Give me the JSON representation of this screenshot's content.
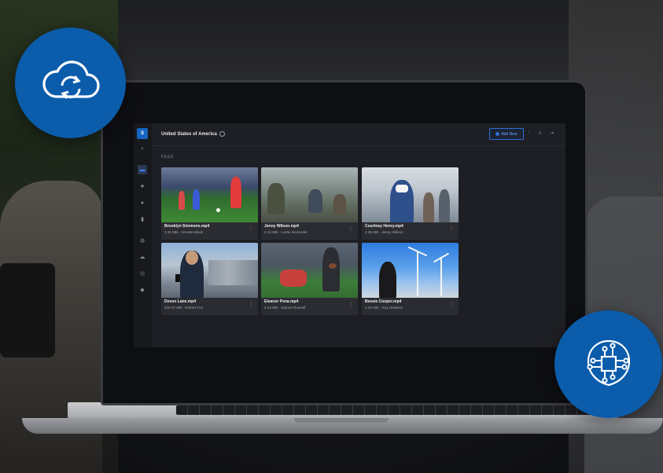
{
  "app": {
    "logo_letter": "S",
    "breadcrumb": "United States of America",
    "add_button": "Add New",
    "section_label": "FILES",
    "accent": "#1565c0"
  },
  "sidebar": {
    "items": [
      {
        "icon": "search-icon",
        "glyph": "⌕"
      },
      {
        "icon": "folder-icon",
        "glyph": "▬",
        "active": true
      },
      {
        "icon": "star-icon",
        "glyph": "★"
      },
      {
        "icon": "clock-icon",
        "glyph": "●"
      },
      {
        "icon": "trash-icon",
        "glyph": "▮"
      },
      {
        "icon": "globe-icon",
        "glyph": "◍"
      },
      {
        "icon": "cloud-icon",
        "glyph": "☁"
      },
      {
        "icon": "settings-icon",
        "glyph": "◎"
      },
      {
        "icon": "location-icon",
        "glyph": "◆"
      }
    ]
  },
  "toolbar": {
    "icons": [
      "filter-icon",
      "list-view-icon",
      "collapse-icon"
    ]
  },
  "files": [
    {
      "name": "Brooklyn Simmons.mp4",
      "meta": "2.31 MB - Annette Black"
    },
    {
      "name": "Jenny Wilson.mp4",
      "meta": "2.34 MB - Leslie Alexander"
    },
    {
      "name": "Courtney Henry.mp4",
      "meta": "2.36 MB - Jenny Wilson"
    },
    {
      "name": "Devon Lane.mp4",
      "meta": "240.37 MB - Robert Fox"
    },
    {
      "name": "Eleanor Pena.mp4",
      "meta": "2.24 MB - Dianne Russell"
    },
    {
      "name": "Bessie Cooper.mp4",
      "meta": "2.22 MB - Guy Hawkins"
    }
  ],
  "badges": {
    "left": "cloud-sync-icon",
    "right": "ai-chip-icon",
    "color": "#0b5cab"
  }
}
